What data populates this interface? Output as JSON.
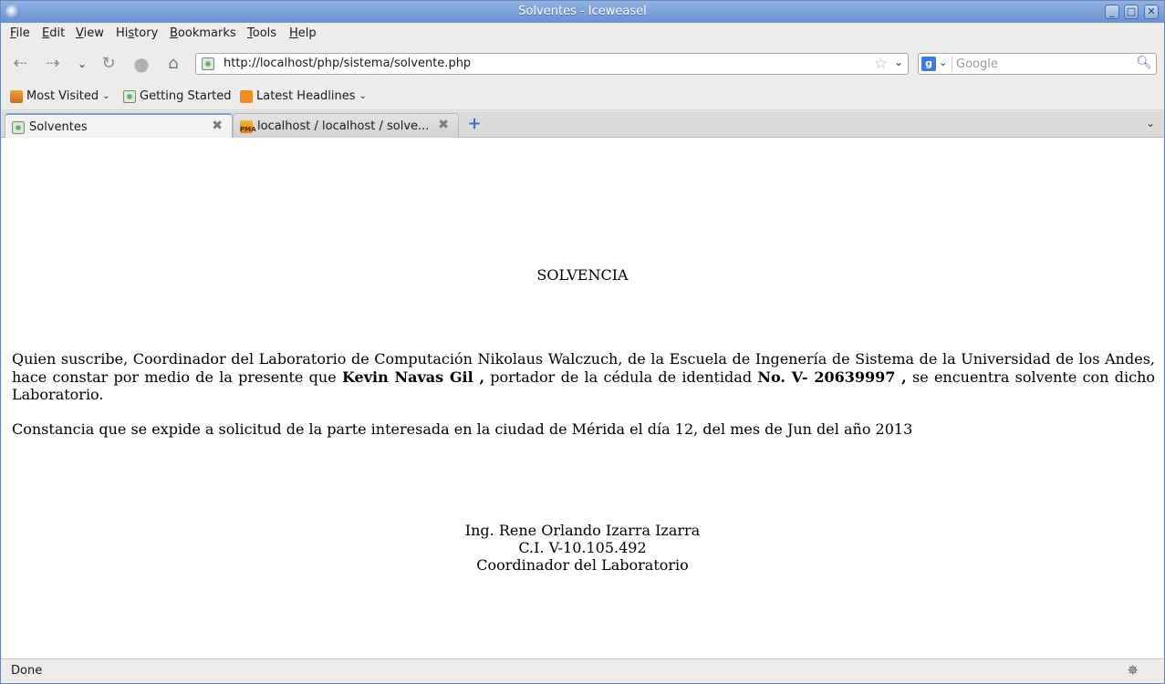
{
  "window": {
    "title": "Solventes - Iceweasel",
    "controls": [
      "_",
      "□",
      "✕"
    ]
  },
  "menu": [
    {
      "label_ul": "F",
      "label_rest": "ile"
    },
    {
      "label_ul": "E",
      "label_rest": "dit"
    },
    {
      "label_ul": "V",
      "label_rest": "iew"
    },
    {
      "label_pre": "Hi",
      "label_ul": "s",
      "label_rest": "tory"
    },
    {
      "label_ul": "B",
      "label_rest": "ookmarks"
    },
    {
      "label_ul": "T",
      "label_rest": "ools"
    },
    {
      "label_ul": "H",
      "label_rest": "elp"
    }
  ],
  "navigation": {
    "url": "http://localhost/php/sistema/solvente.php",
    "search_placeholder": "Google",
    "search_engine": "g"
  },
  "bookmarks": {
    "most_visited": "Most Visited",
    "getting_started": "Getting Started",
    "latest_headlines": "Latest Headlines"
  },
  "tabs": [
    {
      "label": "Solventes",
      "active": true
    },
    {
      "label": "localhost / localhost / solve...",
      "active": false,
      "icon_text": "PMA"
    }
  ],
  "document": {
    "title": "SOLVENCIA",
    "para1_a": "Quien suscribe, Coordinador del Laboratorio de Computación Nikolaus Walczuch, de la Escuela de Ingenería de Sistema de la Universidad de los Andes, hace constar por medio de la presente que ",
    "student_name": "Kevin Navas Gil ,",
    "para1_b": " portador de la cédula de identidad ",
    "id_number": "No. V- 20639997 ,",
    "para1_c": " se encuentra solvente con dicho Laboratorio.",
    "para2": "Constancia que se expide a solicitud de la parte interesada en la ciudad de Mérida el día 12, del mes de Jun del año 2013",
    "signature": {
      "name": "Ing. Rene Orlando Izarra Izarra",
      "ci": "C.I. V-10.105.492",
      "role": "Coordinador del Laboratorio"
    }
  },
  "status": {
    "text": "Done"
  }
}
